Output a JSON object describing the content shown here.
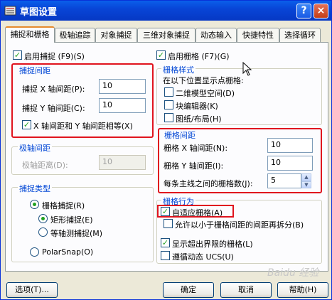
{
  "window": {
    "title": "草图设置",
    "help_btn": "?",
    "close_btn": "×"
  },
  "tabs": [
    "捕捉和栅格",
    "极轴追踪",
    "对象捕捉",
    "三维对象捕捉",
    "动态输入",
    "快捷特性",
    "选择循环"
  ],
  "snap": {
    "enable_label": "启用捕捉 (F9)(S)",
    "spacing_group": "捕捉间距",
    "x_label": "捕捉 X 轴间距(P):",
    "x_value": "10",
    "y_label": "捕捉 Y 轴间距(C):",
    "y_value": "10",
    "equal_label": "X 轴间距和 Y 轴间距相等(X)"
  },
  "polar": {
    "group": "极轴间距",
    "distance_label": "极轴距离(D):",
    "distance_value": "10"
  },
  "snap_type": {
    "group": "捕捉类型",
    "grid_snap": "栅格捕捉(R)",
    "rect_snap": "矩形捕捉(E)",
    "iso_snap": "等轴测捕捉(M)",
    "polar_snap": "PolarSnap(O)"
  },
  "grid": {
    "enable_label": "启用栅格 (F7)(G)",
    "style_group": "栅格样式",
    "style_desc": "在以下位置显示点栅格:",
    "model_space": "二维模型空间(D)",
    "block_editor": "块编辑器(K)",
    "layout": "图纸/布局(H)",
    "spacing_group": "栅格间距",
    "x_label": "栅格 X 轴间距(N):",
    "x_value": "10",
    "y_label": "栅格 Y 轴间距(I):",
    "y_value": "10",
    "major_label": "每条主线之间的栅格数(J):",
    "major_value": "5",
    "behavior_group": "栅格行为",
    "adaptive": "自适应栅格(A)",
    "subdivide": "允许以小于栅格间距的间距再拆分(B)",
    "beyond_limits": "显示超出界限的栅格(L)",
    "follow_ucs": "遵循动态 UCS(U)"
  },
  "buttons": {
    "options": "选项(T)...",
    "ok": "确定",
    "cancel": "取消",
    "help": "帮助(H)"
  },
  "watermark": "Baidu 经验"
}
